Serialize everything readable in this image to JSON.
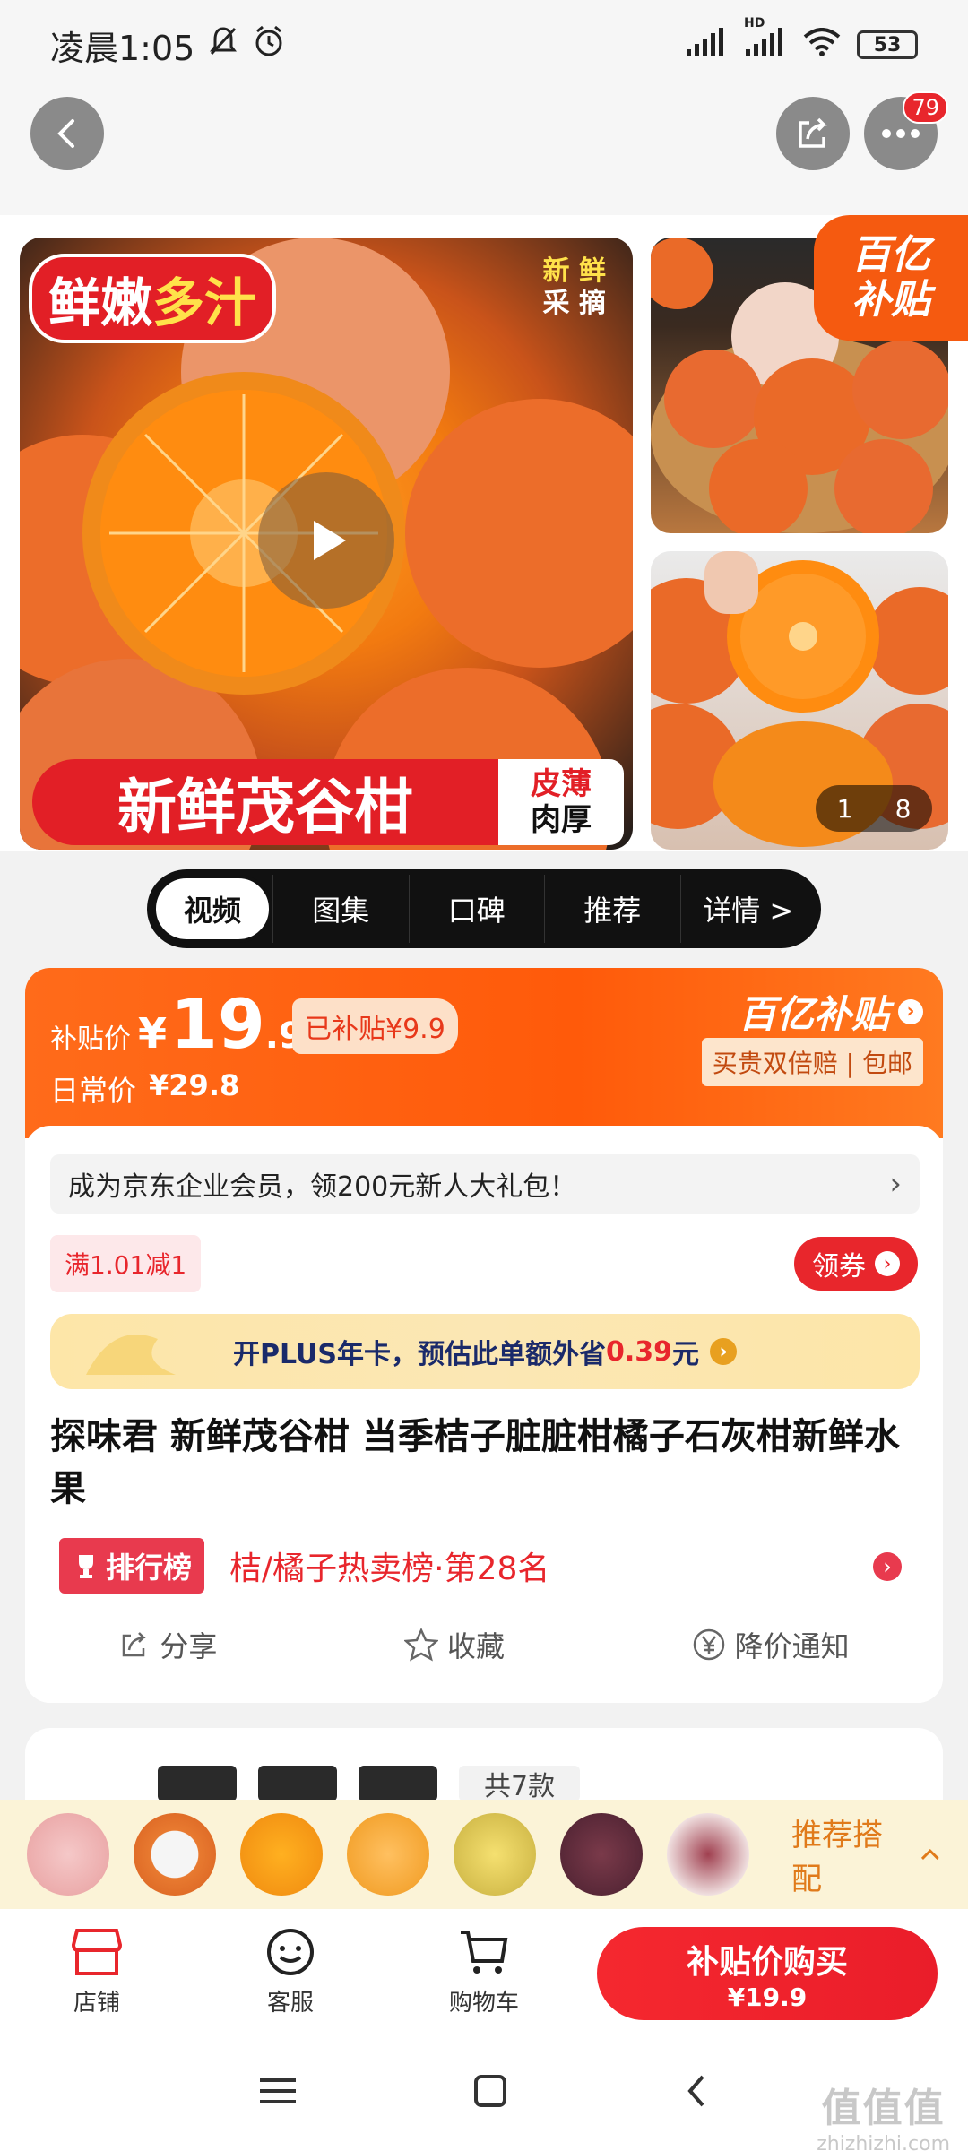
{
  "status_bar": {
    "time": "凌晨1:05",
    "battery": "53",
    "hd_label": "HD"
  },
  "top": {
    "more_badge": "79"
  },
  "gallery": {
    "main_tag": "鲜嫩多汁",
    "main_tag_a": "鲜嫩",
    "main_tag_b": "多汁",
    "fresh_pick_1": "新 鲜",
    "fresh_pick_2": "采 摘",
    "main_title": "新鲜茂谷柑",
    "side_tag_1": "皮薄",
    "side_tag_2": "肉厚",
    "subsidy_1": "百亿",
    "subsidy_2": "补贴",
    "counter_current": "1",
    "counter_total": "8"
  },
  "tabs": [
    {
      "label": "视频",
      "active": true
    },
    {
      "label": "图集",
      "active": false
    },
    {
      "label": "口碑",
      "active": false
    },
    {
      "label": "推荐",
      "active": false
    },
    {
      "label": "详情 >",
      "active": false
    }
  ],
  "price": {
    "subsidy_label": "补贴价",
    "currency": "¥",
    "integer": "19",
    "decimal": ".9",
    "subsidized": "已补贴¥9.9",
    "daily_label": "日常价",
    "daily_price": "¥29.8",
    "brand": "百亿补贴",
    "guarantee": "买贵双倍赔 | 包邮"
  },
  "promo": {
    "text": "成为京东企业会员，领200元新人大礼包！",
    "arrow": "›"
  },
  "coupon": {
    "label": "满1.01减1",
    "get_label": "领券"
  },
  "plus": {
    "prefix": "开PLUS年卡，预估此单额外省",
    "amount": "0.39",
    "suffix": "元"
  },
  "product": {
    "title": "探味君 新鲜茂谷柑 当季桔子脏脏柑橘子石灰柑新鲜水果"
  },
  "rank": {
    "badge": "排行榜",
    "text": "桔/橘子热卖榜·第28名"
  },
  "actions": {
    "share": "分享",
    "collect": "收藏",
    "notify": "降价通知"
  },
  "recommend": {
    "label": "推荐搭配",
    "partial_label": "共7款"
  },
  "bottom": {
    "store": "店铺",
    "service": "客服",
    "cart": "购物车",
    "buy_label": "补贴价购买",
    "buy_price": "¥19.9"
  },
  "watermark": {
    "line1": "值值值",
    "line2": "zhizhizhi.com"
  },
  "colors": {
    "accent": "#e8262c",
    "orange": "#ff6b1a",
    "plus_bg": "#fde6a8"
  }
}
